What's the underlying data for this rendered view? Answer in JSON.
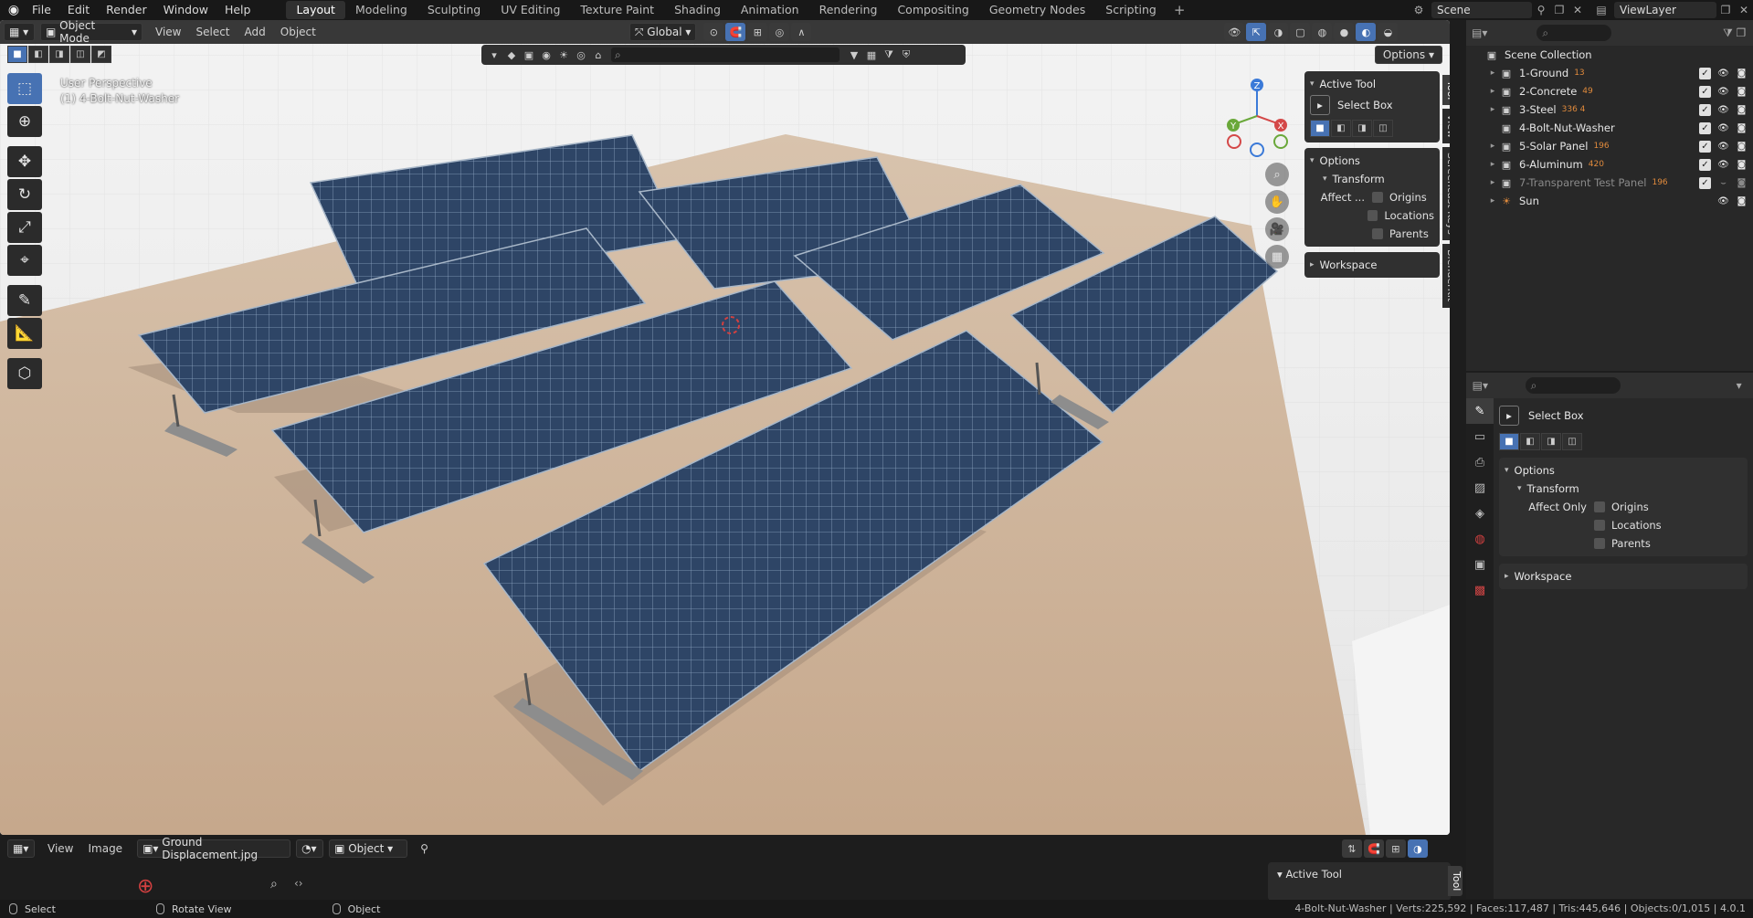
{
  "menu": [
    "File",
    "Edit",
    "Render",
    "Window",
    "Help"
  ],
  "workspaces": [
    "Layout",
    "Modeling",
    "Sculpting",
    "UV Editing",
    "Texture Paint",
    "Shading",
    "Animation",
    "Rendering",
    "Compositing",
    "Geometry Nodes",
    "Scripting"
  ],
  "active_workspace": "Layout",
  "add_tab": "+",
  "scene_name": "Scene",
  "view_layer": "ViewLayer",
  "viewport": {
    "mode": "Object Mode",
    "menus": [
      "View",
      "Select",
      "Add",
      "Object"
    ],
    "orientation": "Global",
    "options": "Options",
    "overlay_title": "User Perspective",
    "overlay_object": "(1) 4-Bolt-Nut-Washer",
    "gizmo_axes": [
      "Z",
      "Y",
      "X"
    ]
  },
  "npanel": {
    "active_tool": "Active Tool",
    "tool_name": "Select Box",
    "options": "Options",
    "transform": "Transform",
    "affect": "Affect ...",
    "checks": [
      "Origins",
      "Locations",
      "Parents"
    ],
    "workspace": "Workspace",
    "tabs": [
      "Tool",
      "View",
      "Screencast Keys",
      "BlenderKit"
    ]
  },
  "bottom_editor": {
    "menus": [
      "View",
      "Image"
    ],
    "image_name": "Ground Displacement.jpg",
    "mode": "Object",
    "active_tool": "Active Tool",
    "tab": "Tool"
  },
  "status": {
    "items": [
      "Select",
      "Rotate View",
      "Object"
    ],
    "stats": "4-Bolt-Nut-Washer | Verts:225,592 | Faces:117,487 | Tris:445,646 | Objects:0/1,015 | 4.0.1"
  },
  "outliner": {
    "root": "Scene Collection",
    "rows": [
      {
        "name": "1-Ground",
        "count": "13",
        "dim": false,
        "exp": true
      },
      {
        "name": "2-Concrete",
        "count": "49",
        "dim": false,
        "exp": true
      },
      {
        "name": "3-Steel",
        "count": "336 4",
        "dim": false,
        "exp": true
      },
      {
        "name": "4-Bolt-Nut-Washer",
        "count": "",
        "dim": false,
        "exp": false
      },
      {
        "name": "5-Solar Panel",
        "count": "196",
        "dim": false,
        "exp": true
      },
      {
        "name": "6-Aluminum",
        "count": "420",
        "dim": false,
        "exp": true
      },
      {
        "name": "7-Transparent Test Panel",
        "count": "196",
        "dim": true,
        "exp": true
      },
      {
        "name": "Sun",
        "count": "",
        "dim": false,
        "exp": true
      }
    ]
  },
  "properties": {
    "tool_name": "Select Box",
    "options": "Options",
    "transform": "Transform",
    "affect_only": "Affect Only",
    "checks": [
      "Origins",
      "Locations",
      "Parents"
    ],
    "workspace": "Workspace"
  },
  "colors": {
    "accent": "#4772b3",
    "count": "#e08a3c",
    "ground": "#c9ab8f",
    "panel": "#2f4665"
  }
}
